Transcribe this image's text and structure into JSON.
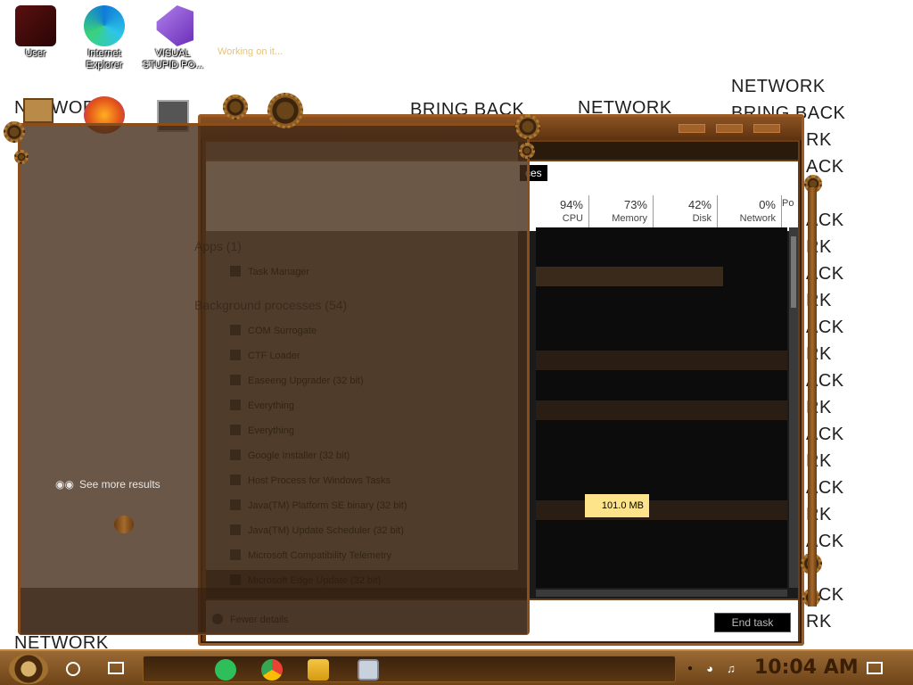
{
  "wallpaper": {
    "words": [
      "NETWORK",
      "BRING BACK"
    ]
  },
  "desktop_icons": [
    {
      "label": "User"
    },
    {
      "label": "Internet Explorer"
    },
    {
      "label": "VISUAL STUPID PO..."
    }
  ],
  "task_manager": {
    "tab_visible": "ces",
    "columns": [
      {
        "pct": "94%",
        "name": "CPU"
      },
      {
        "pct": "73%",
        "name": "Memory"
      },
      {
        "pct": "42%",
        "name": "Disk"
      },
      {
        "pct": "0%",
        "name": "Network"
      },
      {
        "pct": "",
        "name": "Po"
      }
    ],
    "highlight_value": "101.0 MB",
    "end_task_label": "End task",
    "fewer_details_label": "Fewer details"
  },
  "search_panel": {
    "status": "Working on it...",
    "see_more": "See more results",
    "sections": [
      "Apps (1)",
      "Background processes (54)"
    ],
    "rows": [
      "Task Manager",
      "COM Surrogate",
      "CTF Loader",
      "Easeeng Upgrader (32 bit)",
      "Everything",
      "Everything",
      "Google Installer (32 bit)",
      "Host Process for Windows Tasks",
      "Java(TM) Platform SE binary (32 bit)",
      "Java(TM) Update Scheduler (32 bit)",
      "Microsoft Compatibility Telemetry",
      "Microsoft Edge Update (32 bit)"
    ]
  },
  "taskbar": {
    "clock": "10:04 AM",
    "apps": [
      "chat-app",
      "chrome",
      "file-explorer",
      "task-manager"
    ]
  },
  "colors": {
    "frame_brown": "#6b3d16",
    "clock_text": "#3a1e05",
    "highlight": "#fde48a"
  }
}
